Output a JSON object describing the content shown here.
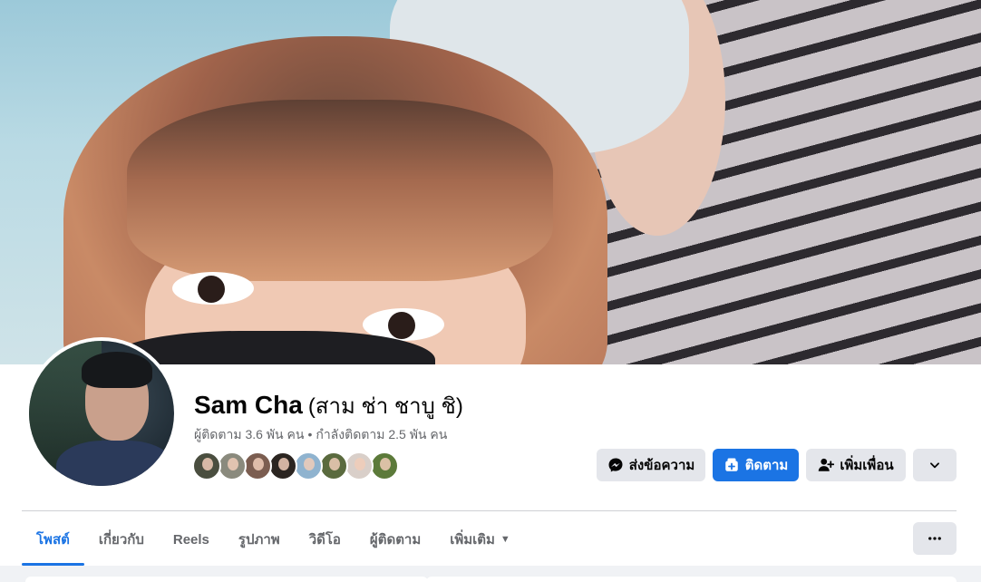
{
  "profile": {
    "name": "Sam Cha",
    "alt_name": "(สาม ช่า ชาบู ชิ)",
    "followers": "ผู้ติดตาม 3.6 พัน คน",
    "following": "กำลังติดตาม 2.5 พัน คน",
    "separator": "•"
  },
  "friends": [
    {
      "color": "#4a4e3f"
    },
    {
      "color": "#8a8a7d"
    },
    {
      "color": "#7b5d50"
    },
    {
      "color": "#2b2521"
    },
    {
      "color": "#8fb3cf"
    },
    {
      "color": "#5a6a3e"
    },
    {
      "color": "#d9cfc9"
    },
    {
      "color": "#5c7a3a"
    }
  ],
  "actions": {
    "message_label": "ส่งข้อความ",
    "follow_label": "ติดตาม",
    "add_friend_label": "เพิ่มเพื่อน"
  },
  "tabs": [
    {
      "label": "โพสต์",
      "active": true
    },
    {
      "label": "เกี่ยวกับ"
    },
    {
      "label": "Reels"
    },
    {
      "label": "รูปภาพ"
    },
    {
      "label": "วิดีโอ"
    },
    {
      "label": "ผู้ติดตาม"
    },
    {
      "label": "เพิ่มเติม"
    }
  ],
  "colors": {
    "accent": "#1b74e4",
    "secondary_text": "#65676b",
    "button_gray": "#e4e6eb"
  }
}
